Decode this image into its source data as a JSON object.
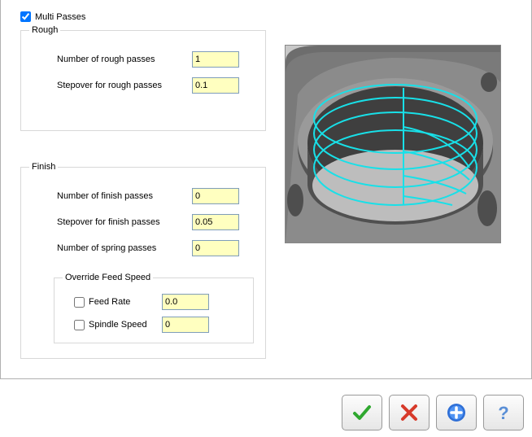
{
  "multiPasses": {
    "label": "Multi Passes",
    "checked": true
  },
  "rough": {
    "legend": "Rough",
    "numPasses": {
      "label": "Number of rough passes",
      "value": "1"
    },
    "stepover": {
      "label": "Stepover for rough passes",
      "value": "0.1"
    }
  },
  "finish": {
    "legend": "Finish",
    "numPasses": {
      "label": "Number of finish passes",
      "value": "0"
    },
    "stepover": {
      "label": "Stepover for finish passes",
      "value": "0.05"
    },
    "springPasses": {
      "label": "Number of spring passes",
      "value": "0"
    },
    "override": {
      "legend": "Override Feed Speed",
      "feedRate": {
        "label": "Feed Rate",
        "checked": false,
        "value": "0.0"
      },
      "spindleSpeed": {
        "label": "Spindle Speed",
        "checked": false,
        "value": "0"
      }
    }
  },
  "buttons": {
    "ok": "ok",
    "cancel": "cancel",
    "add": "add",
    "help": "help"
  },
  "icons": {
    "check": "check-icon",
    "cross": "cross-icon",
    "plus": "plus-icon",
    "question": "question-icon"
  }
}
